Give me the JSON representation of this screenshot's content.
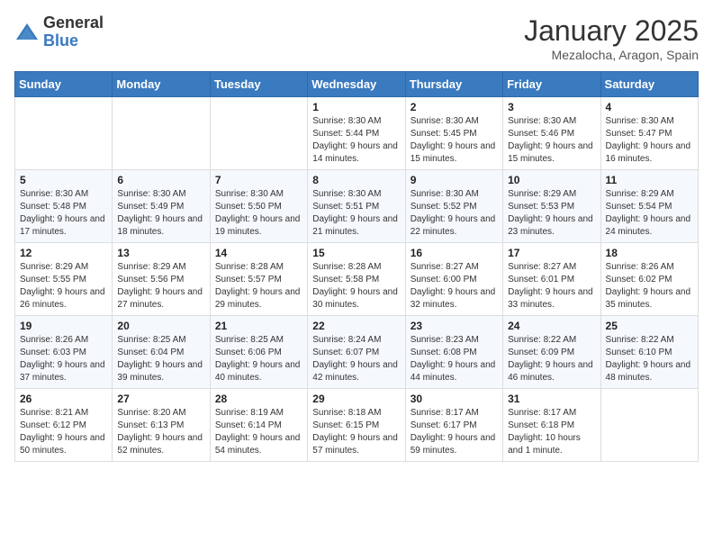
{
  "header": {
    "logo_general": "General",
    "logo_blue": "Blue",
    "month": "January 2025",
    "location": "Mezalocha, Aragon, Spain"
  },
  "days_of_week": [
    "Sunday",
    "Monday",
    "Tuesday",
    "Wednesday",
    "Thursday",
    "Friday",
    "Saturday"
  ],
  "weeks": [
    [
      {
        "day": "",
        "info": ""
      },
      {
        "day": "",
        "info": ""
      },
      {
        "day": "",
        "info": ""
      },
      {
        "day": "1",
        "info": "Sunrise: 8:30 AM\nSunset: 5:44 PM\nDaylight: 9 hours\nand 14 minutes."
      },
      {
        "day": "2",
        "info": "Sunrise: 8:30 AM\nSunset: 5:45 PM\nDaylight: 9 hours\nand 15 minutes."
      },
      {
        "day": "3",
        "info": "Sunrise: 8:30 AM\nSunset: 5:46 PM\nDaylight: 9 hours\nand 15 minutes."
      },
      {
        "day": "4",
        "info": "Sunrise: 8:30 AM\nSunset: 5:47 PM\nDaylight: 9 hours\nand 16 minutes."
      }
    ],
    [
      {
        "day": "5",
        "info": "Sunrise: 8:30 AM\nSunset: 5:48 PM\nDaylight: 9 hours\nand 17 minutes."
      },
      {
        "day": "6",
        "info": "Sunrise: 8:30 AM\nSunset: 5:49 PM\nDaylight: 9 hours\nand 18 minutes."
      },
      {
        "day": "7",
        "info": "Sunrise: 8:30 AM\nSunset: 5:50 PM\nDaylight: 9 hours\nand 19 minutes."
      },
      {
        "day": "8",
        "info": "Sunrise: 8:30 AM\nSunset: 5:51 PM\nDaylight: 9 hours\nand 21 minutes."
      },
      {
        "day": "9",
        "info": "Sunrise: 8:30 AM\nSunset: 5:52 PM\nDaylight: 9 hours\nand 22 minutes."
      },
      {
        "day": "10",
        "info": "Sunrise: 8:29 AM\nSunset: 5:53 PM\nDaylight: 9 hours\nand 23 minutes."
      },
      {
        "day": "11",
        "info": "Sunrise: 8:29 AM\nSunset: 5:54 PM\nDaylight: 9 hours\nand 24 minutes."
      }
    ],
    [
      {
        "day": "12",
        "info": "Sunrise: 8:29 AM\nSunset: 5:55 PM\nDaylight: 9 hours\nand 26 minutes."
      },
      {
        "day": "13",
        "info": "Sunrise: 8:29 AM\nSunset: 5:56 PM\nDaylight: 9 hours\nand 27 minutes."
      },
      {
        "day": "14",
        "info": "Sunrise: 8:28 AM\nSunset: 5:57 PM\nDaylight: 9 hours\nand 29 minutes."
      },
      {
        "day": "15",
        "info": "Sunrise: 8:28 AM\nSunset: 5:58 PM\nDaylight: 9 hours\nand 30 minutes."
      },
      {
        "day": "16",
        "info": "Sunrise: 8:27 AM\nSunset: 6:00 PM\nDaylight: 9 hours\nand 32 minutes."
      },
      {
        "day": "17",
        "info": "Sunrise: 8:27 AM\nSunset: 6:01 PM\nDaylight: 9 hours\nand 33 minutes."
      },
      {
        "day": "18",
        "info": "Sunrise: 8:26 AM\nSunset: 6:02 PM\nDaylight: 9 hours\nand 35 minutes."
      }
    ],
    [
      {
        "day": "19",
        "info": "Sunrise: 8:26 AM\nSunset: 6:03 PM\nDaylight: 9 hours\nand 37 minutes."
      },
      {
        "day": "20",
        "info": "Sunrise: 8:25 AM\nSunset: 6:04 PM\nDaylight: 9 hours\nand 39 minutes."
      },
      {
        "day": "21",
        "info": "Sunrise: 8:25 AM\nSunset: 6:06 PM\nDaylight: 9 hours\nand 40 minutes."
      },
      {
        "day": "22",
        "info": "Sunrise: 8:24 AM\nSunset: 6:07 PM\nDaylight: 9 hours\nand 42 minutes."
      },
      {
        "day": "23",
        "info": "Sunrise: 8:23 AM\nSunset: 6:08 PM\nDaylight: 9 hours\nand 44 minutes."
      },
      {
        "day": "24",
        "info": "Sunrise: 8:22 AM\nSunset: 6:09 PM\nDaylight: 9 hours\nand 46 minutes."
      },
      {
        "day": "25",
        "info": "Sunrise: 8:22 AM\nSunset: 6:10 PM\nDaylight: 9 hours\nand 48 minutes."
      }
    ],
    [
      {
        "day": "26",
        "info": "Sunrise: 8:21 AM\nSunset: 6:12 PM\nDaylight: 9 hours\nand 50 minutes."
      },
      {
        "day": "27",
        "info": "Sunrise: 8:20 AM\nSunset: 6:13 PM\nDaylight: 9 hours\nand 52 minutes."
      },
      {
        "day": "28",
        "info": "Sunrise: 8:19 AM\nSunset: 6:14 PM\nDaylight: 9 hours\nand 54 minutes."
      },
      {
        "day": "29",
        "info": "Sunrise: 8:18 AM\nSunset: 6:15 PM\nDaylight: 9 hours\nand 57 minutes."
      },
      {
        "day": "30",
        "info": "Sunrise: 8:17 AM\nSunset: 6:17 PM\nDaylight: 9 hours\nand 59 minutes."
      },
      {
        "day": "31",
        "info": "Sunrise: 8:17 AM\nSunset: 6:18 PM\nDaylight: 10 hours\nand 1 minute."
      },
      {
        "day": "",
        "info": ""
      }
    ]
  ]
}
